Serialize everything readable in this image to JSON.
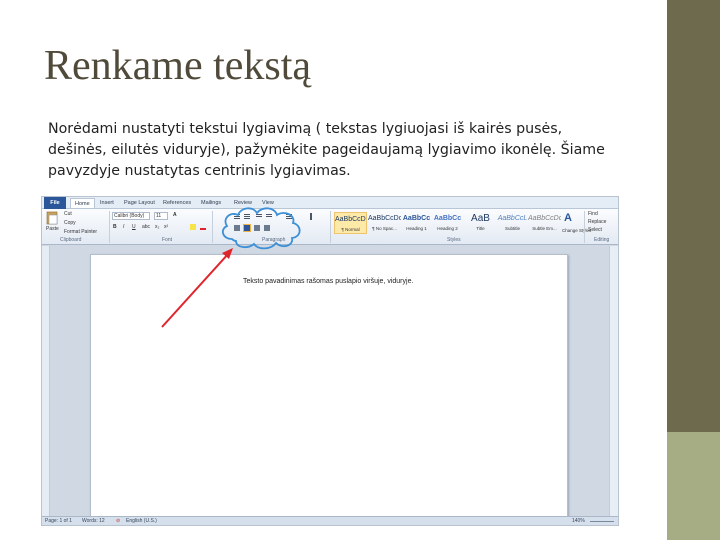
{
  "slide": {
    "title": "Renkame tekstą",
    "body": "Norėdami nustatyti tekstui lygiavimą ( tekstas lygiuojasi iš kairės pusės, dešinės, eilutės viduryje), pažymėkite pageidaujamą lygiavimo ikonėlę. Šiame pavyzdyje nustatytas centrinis lygiavimas.",
    "colors": {
      "title": "#504a3a",
      "side_bar_dark": "#6e6a4e",
      "side_bar_light": "#a6ad85",
      "annotation": "#e0242b",
      "cloud": "#3d8fd6"
    }
  },
  "word": {
    "tabs": [
      "File",
      "Home",
      "Insert",
      "Page Layout",
      "References",
      "Mailings",
      "Review",
      "View"
    ],
    "clipboard": {
      "paste": "Paste",
      "cut": "Cut",
      "copy": "Copy",
      "format_painter": "Format Painter",
      "group": "Clipboard"
    },
    "font": {
      "name": "Calibri (Body)",
      "size": "11",
      "group": "Font"
    },
    "paragraph": {
      "group": "Paragraph"
    },
    "styles": {
      "group": "Styles",
      "items": [
        {
          "sample": "AaBbCcDc",
          "name": "¶ Normal"
        },
        {
          "sample": "AaBbCcDc",
          "name": "¶ No Spac..."
        },
        {
          "sample": "AaBbCc",
          "name": "Heading 1"
        },
        {
          "sample": "AaBbCc",
          "name": "Heading 2"
        },
        {
          "sample": "AaB",
          "name": "Title"
        },
        {
          "sample": "AaBbCcL",
          "name": "Subtitle"
        },
        {
          "sample": "AaBbCcDc",
          "name": "Subtle Em..."
        }
      ],
      "change_styles": "Change Styles"
    },
    "editing": {
      "find": "Find",
      "replace": "Replace",
      "select": "Select",
      "group": "Editing"
    },
    "document_text": "Teksto pavadinimas rašomas puslapio viršuje, viduryje.",
    "status": {
      "page": "Page: 1 of 1",
      "words": "Words: 12",
      "language": "English (U.S.)",
      "zoom": "140%"
    }
  }
}
